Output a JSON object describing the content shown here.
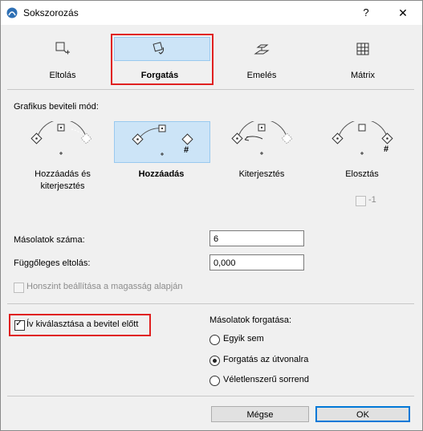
{
  "window": {
    "title": "Sokszorozás",
    "help": "?",
    "close": "✕"
  },
  "tabs": [
    {
      "label": "Eltolás",
      "icon": "move-icon"
    },
    {
      "label": "Forgatás",
      "icon": "rotate-icon",
      "active": true
    },
    {
      "label": "Emelés",
      "icon": "elevate-icon"
    },
    {
      "label": "Mátrix",
      "icon": "matrix-icon"
    }
  ],
  "graphic_input": {
    "title": "Grafikus beviteli mód:",
    "modes": [
      {
        "label": "Hozzáadás és kiterjesztés",
        "selected": false
      },
      {
        "label": "Hozzáadás",
        "selected": true
      },
      {
        "label": "Kiterjesztés",
        "selected": false
      },
      {
        "label": "Elosztás",
        "selected": false
      }
    ],
    "minus_one": "-1",
    "minus_one_checked": false,
    "hash": "#"
  },
  "fields": {
    "copies_label": "Másolatok száma:",
    "copies_value": "6",
    "vertical_offset_label": "Függőleges eltolás:",
    "vertical_offset_value": "0,000",
    "story_label": "Honszint beállítása a magasság alapján",
    "story_checked": false
  },
  "arc_select": {
    "label": "Ív kiválasztása a bevitel előtt",
    "checked": true
  },
  "copy_rotation": {
    "title": "Másolatok forgatása:",
    "options": [
      {
        "label": "Egyik sem",
        "selected": false
      },
      {
        "label": "Forgatás az útvonalra",
        "selected": true
      },
      {
        "label": "Véletlenszerű sorrend",
        "selected": false
      }
    ]
  },
  "buttons": {
    "cancel": "Mégse",
    "ok": "OK"
  },
  "colors": {
    "accent": "#0078d7",
    "highlight": "#cce4f7",
    "callout": "#e02020"
  }
}
